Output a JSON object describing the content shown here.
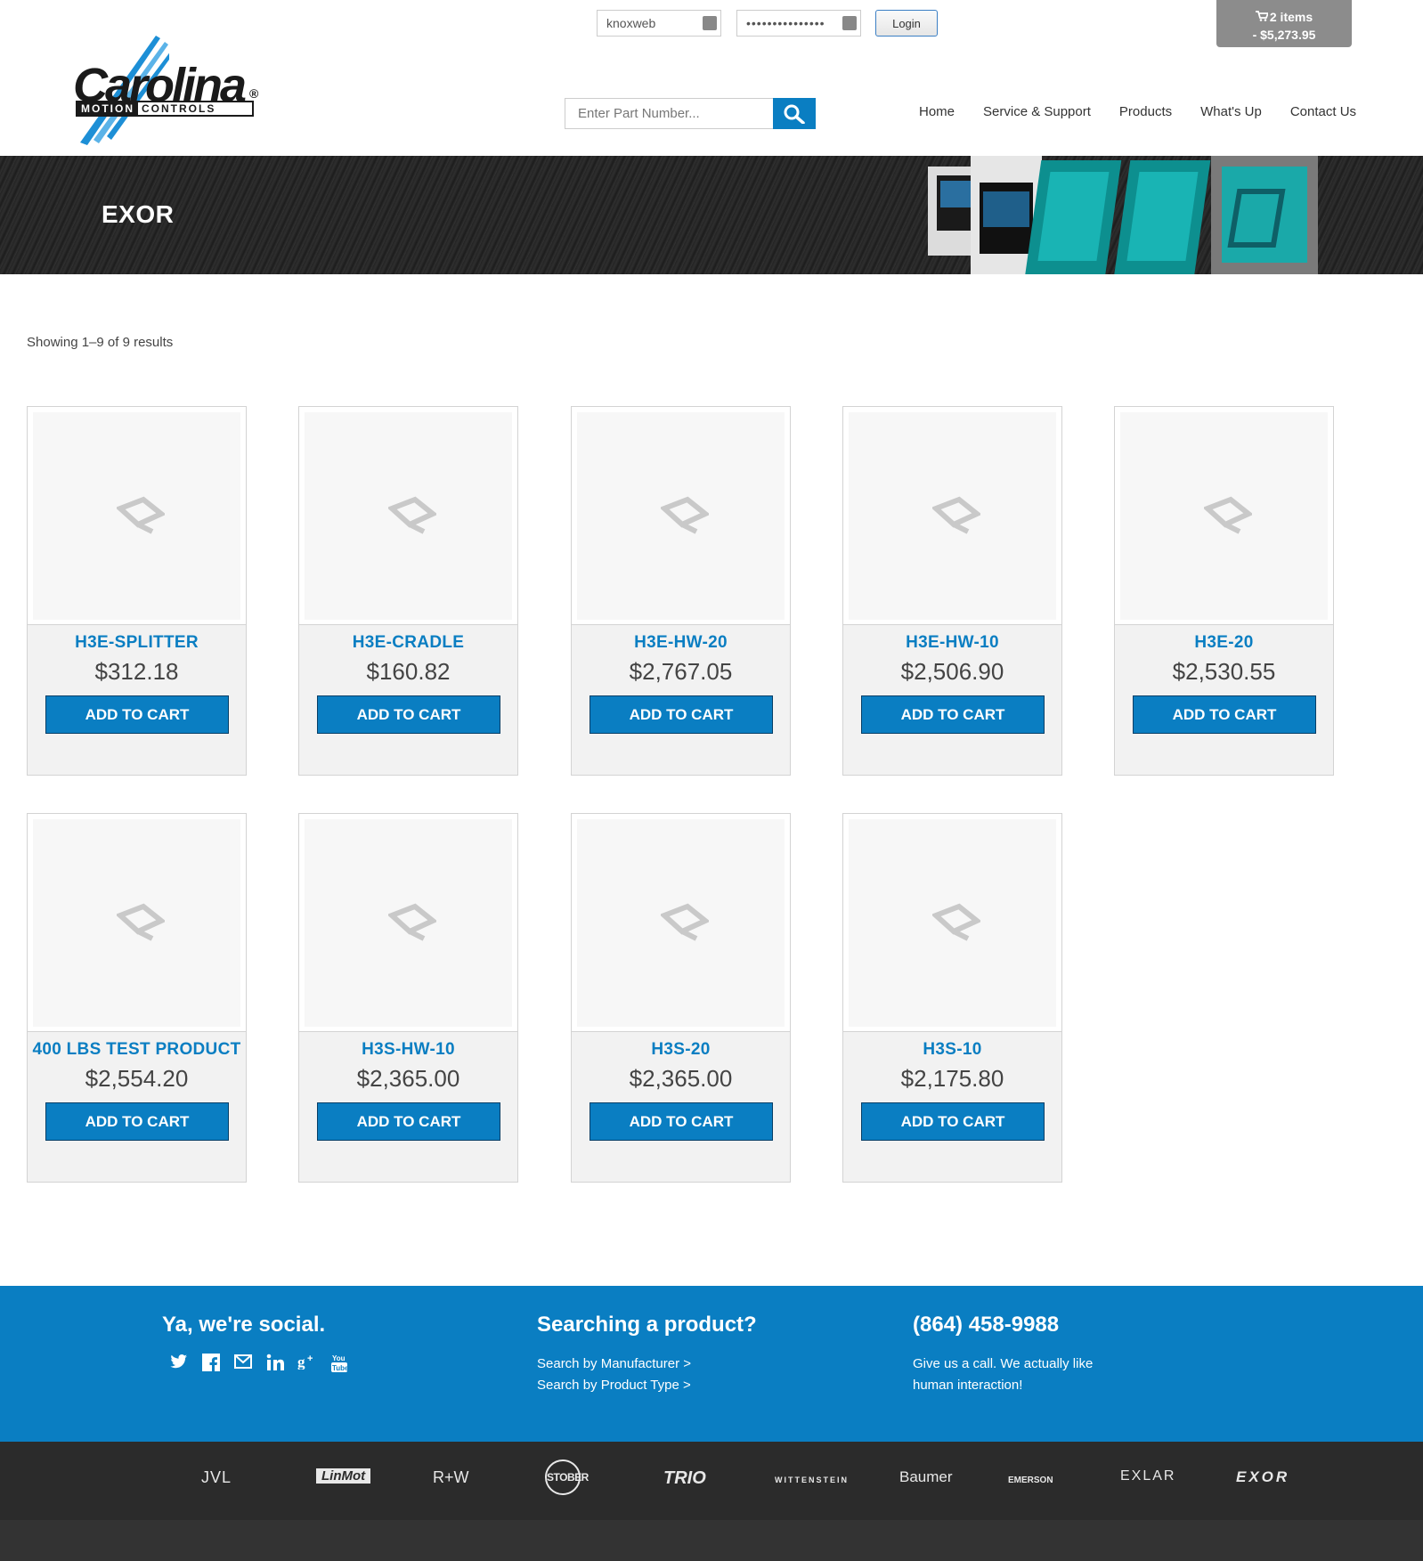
{
  "login": {
    "username_value": "knoxweb",
    "password_value": "•••••••••••••••",
    "login_label": "Login"
  },
  "cart": {
    "items": "2 items",
    "total": "- $5,273.95"
  },
  "logo": {
    "word": "Carolina",
    "reg": "®",
    "sub_a": "MOTION",
    "sub_b": "CONTROLS"
  },
  "search": {
    "placeholder": "Enter Part Number..."
  },
  "nav": [
    "Home",
    "Service & Support",
    "Products",
    "What's Up",
    "Contact Us"
  ],
  "banner": {
    "title": "EXOR"
  },
  "results": {
    "count_text": "Showing 1–9 of 9 results"
  },
  "products": [
    {
      "name": "H3E-SPLITTER",
      "price": "$312.18",
      "button": "ADD TO CART"
    },
    {
      "name": "H3E-CRADLE",
      "price": "$160.82",
      "button": "ADD TO CART"
    },
    {
      "name": "H3E-HW-20",
      "price": "$2,767.05",
      "button": "ADD TO CART"
    },
    {
      "name": "H3E-HW-10",
      "price": "$2,506.90",
      "button": "ADD TO CART"
    },
    {
      "name": "H3E-20",
      "price": "$2,530.55",
      "button": "ADD TO CART"
    },
    {
      "name": "400 LBS TEST PRODUCT",
      "price": "$2,554.20",
      "button": "ADD TO CART"
    },
    {
      "name": "H3S-HW-10",
      "price": "$2,365.00",
      "button": "ADD TO CART"
    },
    {
      "name": "H3S-20",
      "price": "$2,365.00",
      "button": "ADD TO CART"
    },
    {
      "name": "H3S-10",
      "price": "$2,175.80",
      "button": "ADD TO CART"
    }
  ],
  "footer": {
    "social_title": "Ya, we're social.",
    "social_icons": [
      "twitter-icon",
      "facebook-icon",
      "email-icon",
      "linkedin-icon",
      "google-plus-icon",
      "youtube-icon"
    ],
    "search_title": "Searching a product?",
    "search_by_manufacturer": "Search by Manufacturer >",
    "search_by_type": "Search by Product Type >",
    "phone": "(864) 458-9988",
    "call_line1": "Give us a call. We actually like",
    "call_line2": "human interaction!"
  },
  "brands": [
    "JVL",
    "LinMot",
    "R+W",
    "STOBER",
    "TRIO",
    "WITTENSTEIN",
    "Baumer",
    "EMERSON",
    "EXLAR",
    "EXOR"
  ],
  "colors": {
    "accent": "#0a7ec2",
    "banner_bg": "#262626",
    "brand_bar": "#2b2b2b"
  }
}
